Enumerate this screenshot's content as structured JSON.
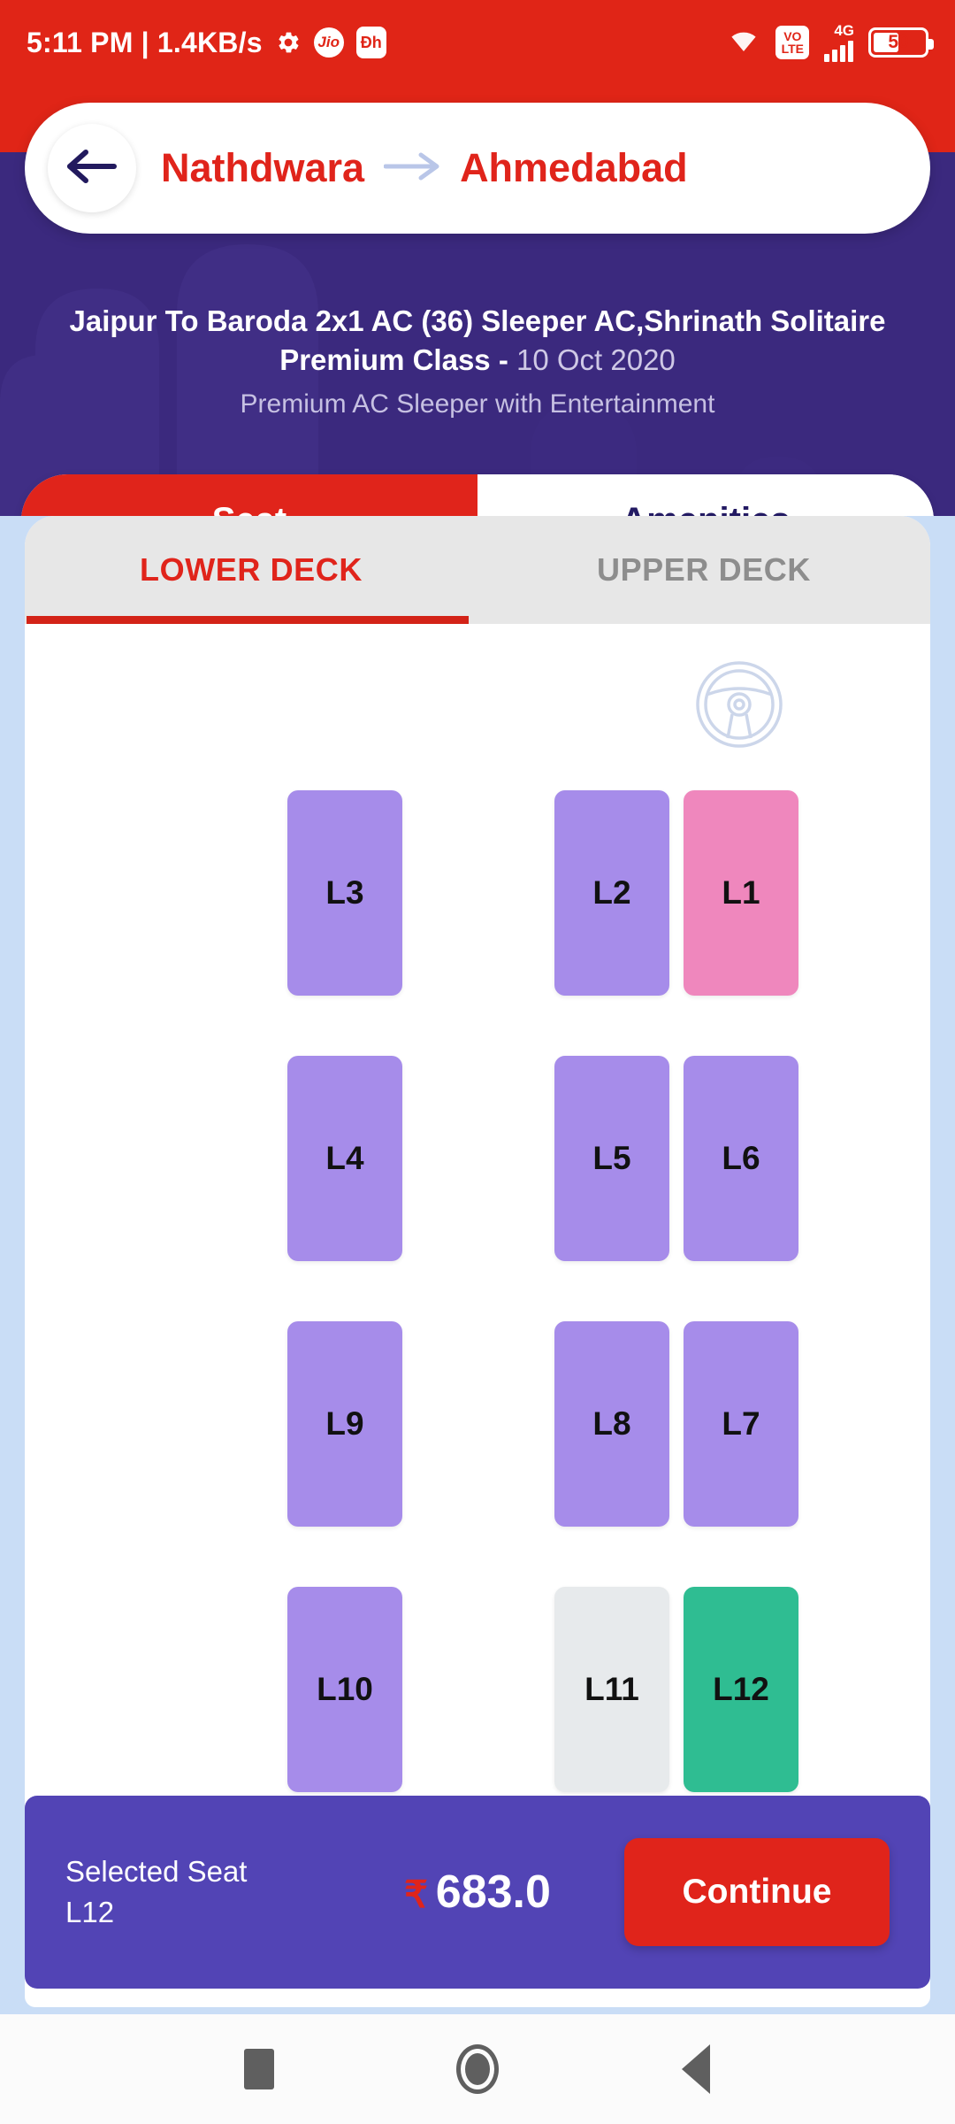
{
  "statusbar": {
    "clock": "5:11 PM | 1.4KB/s",
    "gear_icon": "gear-icon",
    "jio_label": "Jio",
    "dh_label": "Ðh",
    "wifi_icon": "wifi-icon",
    "volte_top": "VO",
    "volte_bottom": "LTE",
    "network_gen": "4G",
    "battery_percent": "50",
    "bg_color": "#e02517"
  },
  "header": {
    "back_icon": "back-arrow-icon",
    "origin": "Nathdwara",
    "arrow_icon": "arrow-right-icon",
    "destination": "Ahmedabad",
    "accent_color": "#e0241b"
  },
  "bus": {
    "title": "Jaipur To Baroda 2x1 AC (36) Sleeper AC,Shrinath Solitaire Premium Class -",
    "date": "10 Oct 2020",
    "subtitle": "Premium AC Sleeper with Entertainment"
  },
  "segments": [
    {
      "label": "Seat",
      "active": true
    },
    {
      "label": "Amenities",
      "active": false
    }
  ],
  "deck_tabs": [
    {
      "label": "LOWER DECK",
      "active": true
    },
    {
      "label": "UPPER DECK",
      "active": false
    }
  ],
  "driver": {
    "icon": "steering-wheel-icon"
  },
  "legend_colors": {
    "available": "#a68cea",
    "ladies": "#ef87bd",
    "booked": "#e7eaec",
    "selected": "#2fbd92"
  },
  "seat_rows": [
    [
      {
        "label": "L3",
        "status": "available",
        "slot": "a"
      },
      {
        "label": "L2",
        "status": "available",
        "slot": "b"
      },
      {
        "label": "L1",
        "status": "ladies",
        "slot": "c"
      }
    ],
    [
      {
        "label": "L4",
        "status": "available",
        "slot": "a"
      },
      {
        "label": "L5",
        "status": "available",
        "slot": "b"
      },
      {
        "label": "L6",
        "status": "available",
        "slot": "c"
      }
    ],
    [
      {
        "label": "L9",
        "status": "available",
        "slot": "a"
      },
      {
        "label": "L8",
        "status": "available",
        "slot": "b"
      },
      {
        "label": "L7",
        "status": "available",
        "slot": "c"
      }
    ],
    [
      {
        "label": "L10",
        "status": "available",
        "slot": "a"
      },
      {
        "label": "L11",
        "status": "booked",
        "slot": "b"
      },
      {
        "label": "L12",
        "status": "selected",
        "slot": "c"
      }
    ]
  ],
  "bottom_bar": {
    "selected_label": "Selected Seat",
    "selected_seat": "L12",
    "currency": "₹",
    "amount": "683.0",
    "continue_label": "Continue",
    "bg_color": "#5244b5"
  },
  "navbar": {
    "recents_icon": "square-recents-icon",
    "home_icon": "circle-home-icon",
    "back_icon": "triangle-back-icon"
  }
}
